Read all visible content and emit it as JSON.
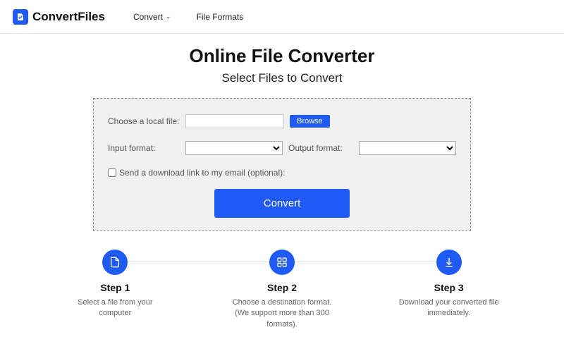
{
  "nav": {
    "brand": "ConvertFiles",
    "items": [
      {
        "label": "Convert",
        "has_dropdown": true
      },
      {
        "label": "File Formats",
        "has_dropdown": false
      }
    ]
  },
  "hero": {
    "title": "Online File Converter",
    "subtitle": "Select Files to Convert"
  },
  "form": {
    "choose_label": "Choose a local file:",
    "browse_label": "Browse",
    "input_format_label": "Input format:",
    "output_format_label": "Output format:",
    "input_format_value": "",
    "output_format_value": "",
    "email_checkbox_label": "Send a download link to my email (optional):",
    "convert_label": "Convert"
  },
  "steps": [
    {
      "title": "Step 1",
      "text": "Select a file from your computer",
      "icon": "file-icon"
    },
    {
      "title": "Step 2",
      "text": "Choose a destination format. (We support more than 300 formats).",
      "icon": "grid-icon"
    },
    {
      "title": "Step 3",
      "text": "Download your converted file immediately.",
      "icon": "download-icon"
    }
  ]
}
